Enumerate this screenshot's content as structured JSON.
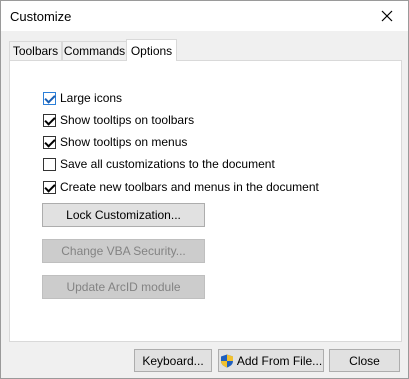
{
  "window": {
    "title": "Customize"
  },
  "tabs": [
    {
      "label": "Toolbars"
    },
    {
      "label": "Commands"
    },
    {
      "label": "Options",
      "active": true
    }
  ],
  "options": [
    {
      "label": "Large icons",
      "checked": true
    },
    {
      "label": "Show tooltips on toolbars",
      "checked": true
    },
    {
      "label": "Show tooltips on menus",
      "checked": true
    },
    {
      "label": "Save all customizations to the document",
      "checked": false
    },
    {
      "label": "Create new toolbars and menus in the document",
      "checked": true
    }
  ],
  "buttons": {
    "lock": "Lock Customization...",
    "vba": "Change VBA Security...",
    "arcid": "Update ArcID module"
  },
  "footer": {
    "keyboard": "Keyboard...",
    "add_from_file": "Add From File...",
    "close": "Close"
  },
  "colors": {
    "accent": "#2b7fd9"
  }
}
